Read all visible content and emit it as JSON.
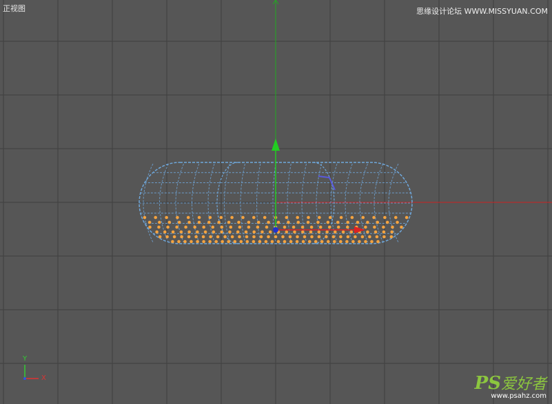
{
  "viewport": {
    "view_name": "正视图",
    "background": "#565656",
    "grid_color": "#3f3f3f"
  },
  "watermark": {
    "top_text": "思缘设计论坛 WWW.MISSYUAN.COM",
    "logo_ps": "PS",
    "logo_cn": "爱好者",
    "url": "www.psahz.com"
  },
  "axes": {
    "world_x_color": "#cc2222",
    "world_y_color": "#22aa22",
    "corner_x_label": "X",
    "corner_y_label": "Y",
    "corner_x_color": "#d33",
    "corner_y_color": "#3c3"
  },
  "object": {
    "wire_color": "#6fa8dc",
    "selected_point_color": "#f4a340",
    "gizmo_z_color": "#2233cc",
    "gizmo_x_color": "#dd2222",
    "gizmo_y_color": "#22cc22"
  }
}
